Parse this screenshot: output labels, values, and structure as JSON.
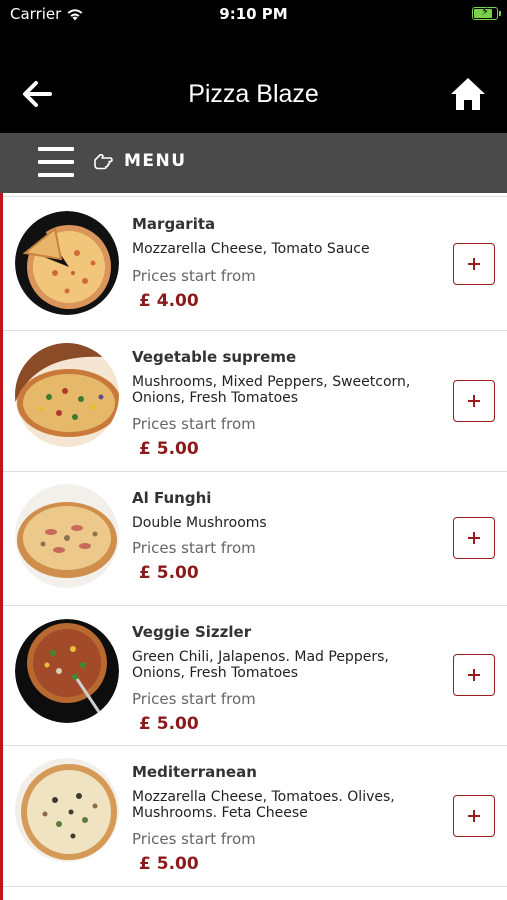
{
  "status_bar": {
    "carrier": "Carrier",
    "time": "9:10 PM",
    "battery_level": 0.85
  },
  "header": {
    "title": "Pizza Blaze",
    "back_icon": "arrow-left-icon",
    "home_icon": "home-icon"
  },
  "menu_bar": {
    "label": "MENU",
    "menu_icon": "hamburger-icon",
    "pointer_icon": "pointing-hand-icon"
  },
  "colors": {
    "header_bg": "#000000",
    "menu_bar_bg": "#4a4a4a",
    "accent_red": "#9b1c1c",
    "price_red": "#8b1a1a",
    "rail_red": "#c1121f"
  },
  "items": [
    {
      "name": "Margarita",
      "description": "Mozzarella Cheese, Tomato Sauce",
      "price_caption": "Prices start from",
      "price": "£ 4.00",
      "image": "margarita-pizza-image"
    },
    {
      "name": "Vegetable supreme",
      "description": "Mushrooms, Mixed Peppers, Sweetcorn, Onions, Fresh Tomatoes",
      "price_caption": "Prices start from",
      "price": "£ 5.00",
      "image": "vegetable-supreme-pizza-image"
    },
    {
      "name": "Al Funghi",
      "description": "Double Mushrooms",
      "price_caption": "Prices start from",
      "price": "£ 5.00",
      "image": "al-funghi-pizza-image"
    },
    {
      "name": "Veggie Sizzler",
      "description": "Green Chili, Jalapenos. Mad Peppers, Onions, Fresh Tomatoes",
      "price_caption": "Prices start from",
      "price": "£ 5.00",
      "image": "veggie-sizzler-pizza-image"
    },
    {
      "name": "Mediterranean",
      "description": "Mozzarella Cheese, Tomatoes. Olives, Mushrooms. Feta Cheese",
      "price_caption": "Prices start from",
      "price": "£ 5.00",
      "image": "mediterranean-pizza-image"
    }
  ]
}
